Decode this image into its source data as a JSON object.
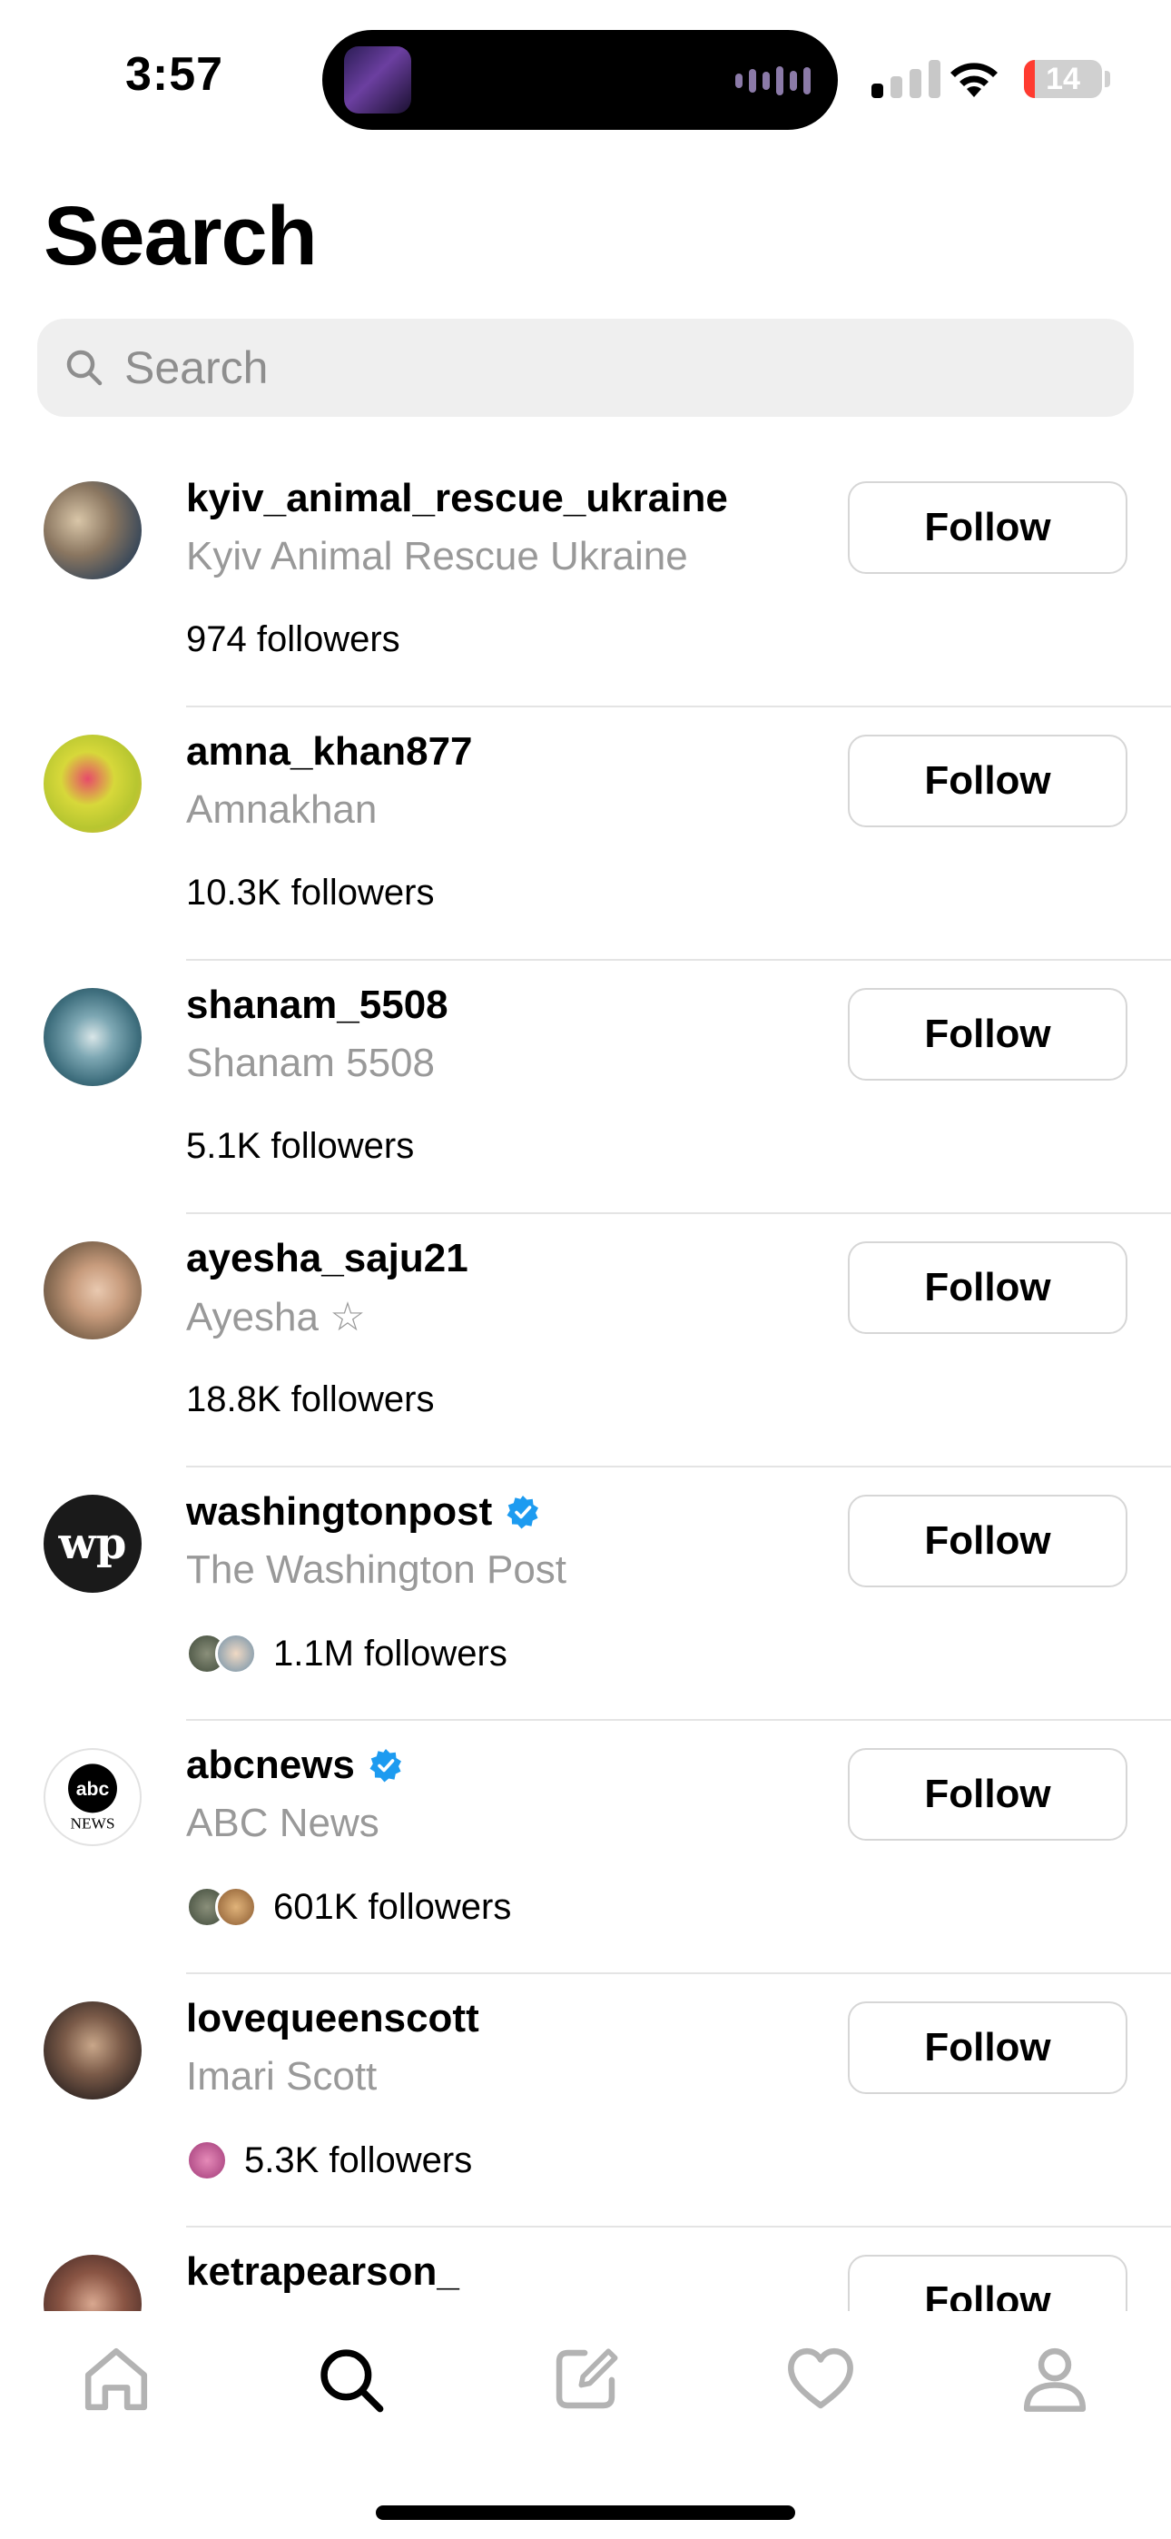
{
  "status_bar": {
    "time": "3:57",
    "battery": "14"
  },
  "page": {
    "title": "Search"
  },
  "search": {
    "placeholder": "Search"
  },
  "colors": {
    "verified": "#1d9bf0",
    "battery_low": "#ff3b30",
    "secondary_text": "#999999"
  },
  "results": [
    {
      "username": "kyiv_animal_rescue_ukraine",
      "display_name": "Kyiv Animal Rescue Ukraine",
      "followers": "974 followers",
      "verified": false,
      "follow_label": "Follow"
    },
    {
      "username": "amna_khan877",
      "display_name": "Amnakhan",
      "followers": "10.3K followers",
      "verified": false,
      "follow_label": "Follow"
    },
    {
      "username": "shanam_5508",
      "display_name": "Shanam 5508",
      "followers": "5.1K followers",
      "verified": false,
      "follow_label": "Follow"
    },
    {
      "username": "ayesha_saju21",
      "display_name": "Ayesha ☆",
      "followers": "18.8K followers",
      "verified": false,
      "follow_label": "Follow"
    },
    {
      "username": "washingtonpost",
      "display_name": "The Washington Post",
      "followers": "1.1M followers",
      "verified": true,
      "follow_label": "Follow"
    },
    {
      "username": "abcnews",
      "display_name": "ABC News",
      "followers": "601K followers",
      "verified": true,
      "follow_label": "Follow"
    },
    {
      "username": "lovequeenscott",
      "display_name": "Imari Scott",
      "followers": "5.3K followers",
      "verified": false,
      "follow_label": "Follow"
    },
    {
      "username": "ketrapearson_",
      "display_name": "",
      "followers": "",
      "verified": false,
      "follow_label": "Follow"
    }
  ],
  "tab_bar": {
    "tabs": [
      "home-icon",
      "search-icon",
      "compose-icon",
      "heart-icon",
      "profile-icon"
    ],
    "active": "search-icon"
  }
}
